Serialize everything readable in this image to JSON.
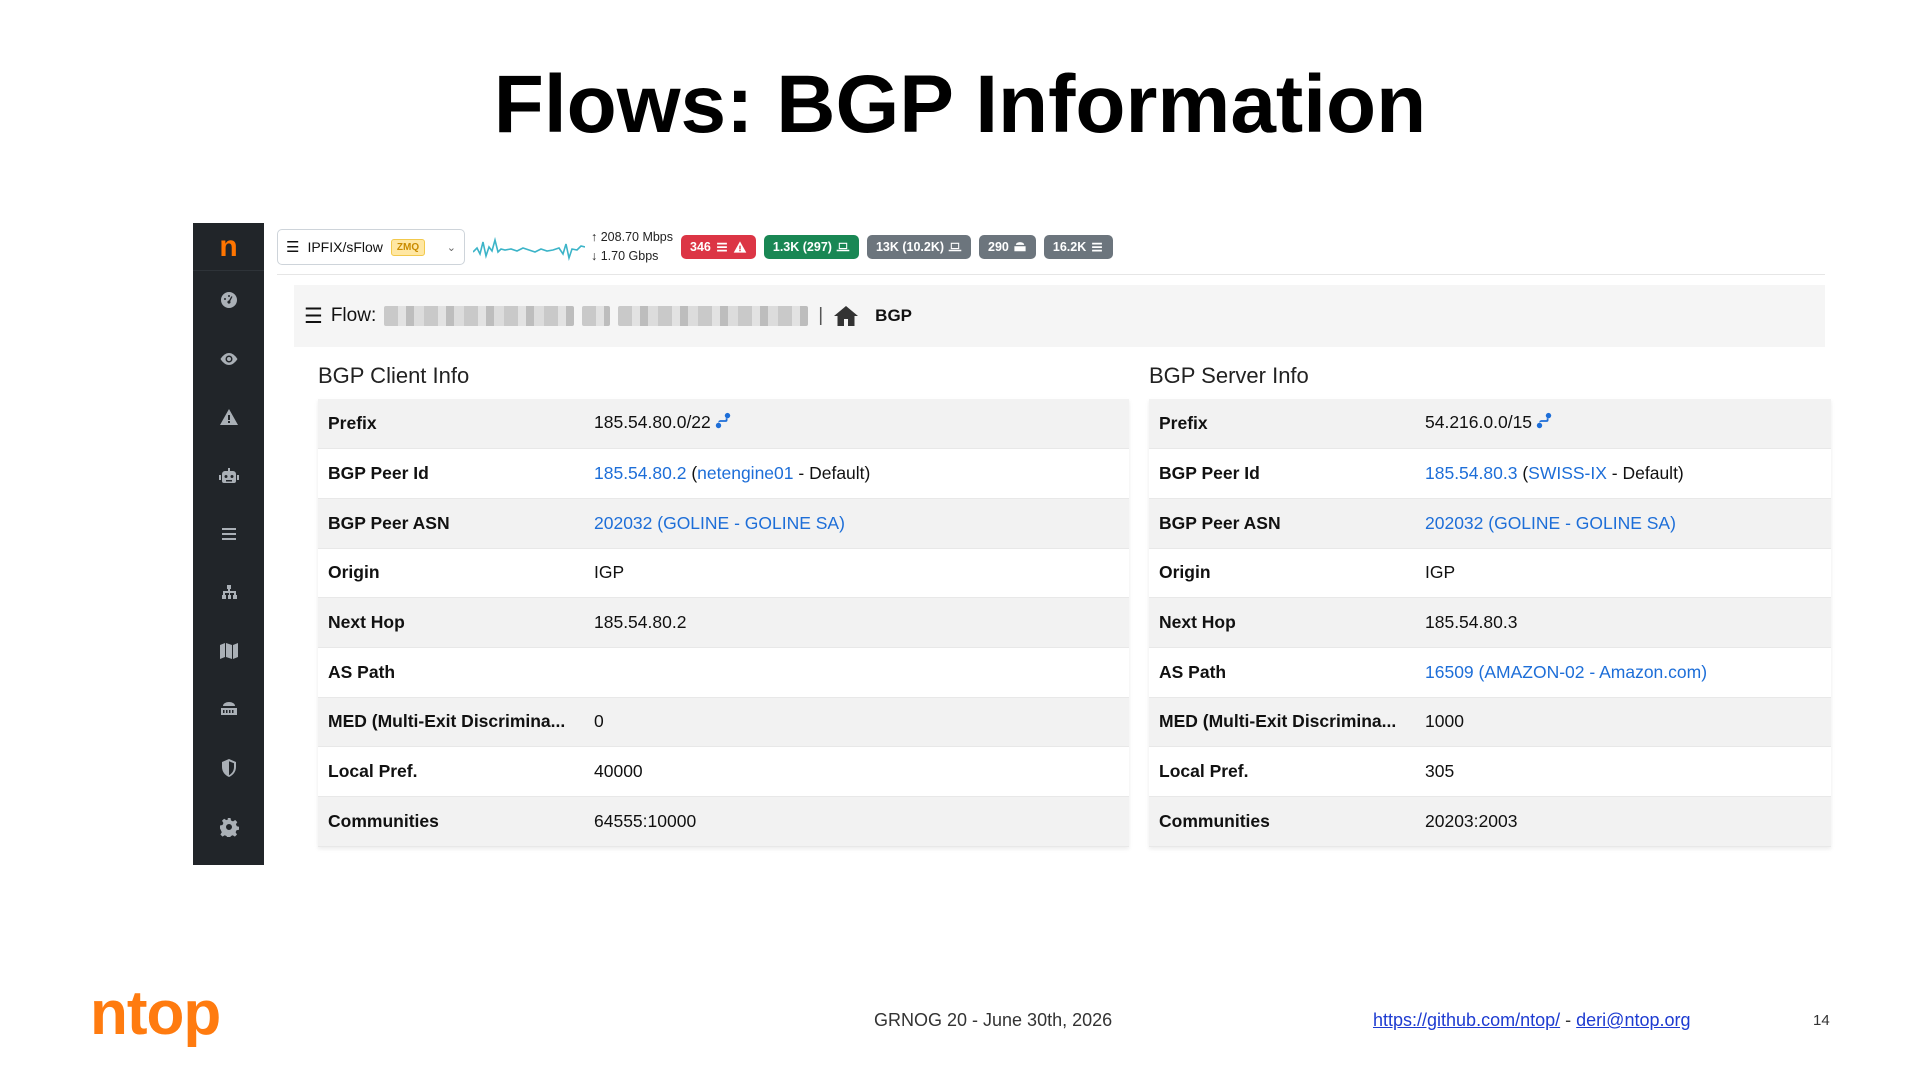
{
  "slide": {
    "title": "Flows: BGP Information",
    "footer_center": "GRNOG 20 - June 30th, 2026",
    "footer_link_github": "https://github.com/ntop/",
    "footer_separator": "-",
    "footer_link_email": "deri@ntop.org",
    "page_number": "14",
    "logo_text": "ntop"
  },
  "sidebar": {
    "logo": "n",
    "items": [
      {
        "icon": "dashboard-icon"
      },
      {
        "icon": "eye-icon"
      },
      {
        "icon": "alert-icon"
      },
      {
        "icon": "robot-icon"
      },
      {
        "icon": "list-icon"
      },
      {
        "icon": "sitemap-icon"
      },
      {
        "icon": "map-icon"
      },
      {
        "icon": "server-icon"
      },
      {
        "icon": "shield-icon"
      },
      {
        "icon": "gear-icon"
      }
    ]
  },
  "topbar": {
    "interface": "IPFIX/sFlow",
    "interface_badge": "ZMQ",
    "upload_rate": "208.70 Mbps",
    "download_rate": "1.70 Gbps",
    "badges": [
      {
        "text": "346",
        "color": "#dc3545",
        "icons": [
          "list-icon",
          "alert-icon"
        ]
      },
      {
        "text": "1.3K (297)",
        "color": "#198754",
        "icons": [
          "laptop-icon"
        ]
      },
      {
        "text": "13K (10.2K)",
        "color": "#6c757d",
        "icons": [
          "laptop-icon"
        ]
      },
      {
        "text": "290",
        "color": "#6c757d",
        "icons": [
          "server-icon"
        ]
      },
      {
        "text": "16.2K",
        "color": "#6c757d",
        "icons": [
          "list-icon"
        ]
      }
    ]
  },
  "breadcrumb": {
    "label": "Flow:",
    "separator": "|",
    "current": "BGP"
  },
  "client": {
    "title": "BGP Client Info",
    "rows": [
      {
        "key": "Prefix",
        "value": "185.54.80.0/22"
      },
      {
        "key": "BGP Peer Id",
        "value_link": "185.54.80.2",
        "value_open": "(",
        "value_link2": "netengine01",
        "value_rest": "- Default)"
      },
      {
        "key": "BGP Peer ASN",
        "value_link": "202032 (GOLINE - GOLINE SA)"
      },
      {
        "key": "Origin",
        "value": "IGP"
      },
      {
        "key": "Next Hop",
        "value": "185.54.80.2"
      },
      {
        "key": "AS Path",
        "value": ""
      },
      {
        "key": "MED (Multi-Exit Discrimina...",
        "value": "0"
      },
      {
        "key": "Local Pref.",
        "value": "40000"
      },
      {
        "key": "Communities",
        "value": "64555:10000"
      }
    ]
  },
  "server": {
    "title": "BGP Server Info",
    "rows": [
      {
        "key": "Prefix",
        "value": "54.216.0.0/15"
      },
      {
        "key": "BGP Peer Id",
        "value_link": "185.54.80.3",
        "value_open": "(",
        "value_link2": "SWISS-IX",
        "value_rest": "- Default)"
      },
      {
        "key": "BGP Peer ASN",
        "value_link": "202032 (GOLINE - GOLINE SA)"
      },
      {
        "key": "Origin",
        "value": "IGP"
      },
      {
        "key": "Next Hop",
        "value": "185.54.80.3"
      },
      {
        "key": "AS Path",
        "value_link": "16509 (AMAZON-02 - Amazon.com)"
      },
      {
        "key": "MED (Multi-Exit Discrimina...",
        "value": "1000"
      },
      {
        "key": "Local Pref.",
        "value": "305"
      },
      {
        "key": "Communities",
        "value": "20203:2003"
      }
    ]
  }
}
